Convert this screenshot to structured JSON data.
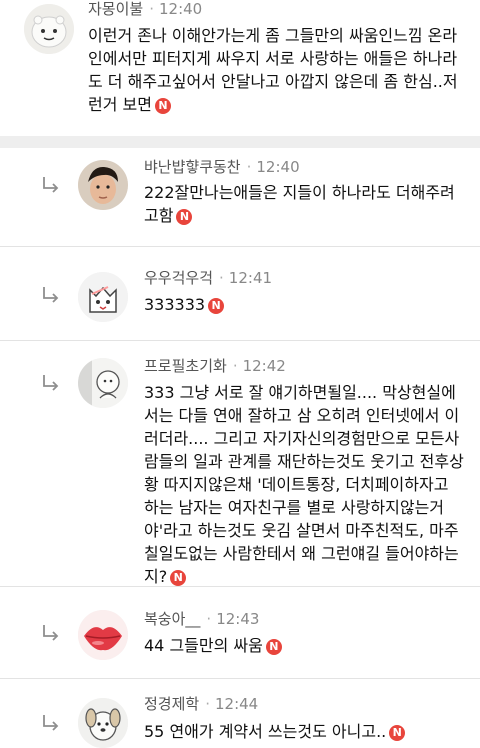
{
  "comments": [
    {
      "nickname": "자몽이불",
      "time": "12:40",
      "text": "이런거 존나 이해안가는게 좀 그들만의 싸움인느낌 온라인에서만 피터지게 싸우지 서로 사랑하는 애들은 하나라도 더 해주고싶어서 안달나고 아깝지 않은데 좀 한심..저런거 보면",
      "badge": "N",
      "avatar_icon": "character-avatar-icon",
      "is_reply": false
    },
    {
      "nickname": "뱌난뱝햫쿠동찬",
      "time": "12:40",
      "text": "222잘만나는애들은 지들이 하나라도 더해주려고함",
      "badge": "N",
      "avatar_icon": "person-photo-avatar-icon",
      "is_reply": true
    },
    {
      "nickname": "우우걱우걱",
      "time": "12:41",
      "text": "333333",
      "badge": "N",
      "avatar_icon": "cat-sketch-avatar-icon",
      "is_reply": true
    },
    {
      "nickname": "프로필초기화",
      "time": "12:42",
      "text": "333 그냥 서로 잘 얘기하면될일.... 막상현실에서는 다들 연애 잘하고 삼 오히려 인터넷에서 이러더라.... 그리고 자기자신의경험만으로 모든사람들의 일과 관계를 재단하는것도 웃기고 전후상황 따지지않은채 '데이트통장, 더치페이하자고 하는 남자는 여자친구를 별로 사랑하지않는거야'라고 하는것도 웃김 살면서 마주친적도, 마주칠일도없는 사람한테서 왜 그런얘길 들어야하는지?",
      "badge": "N",
      "avatar_icon": "drawing-avatar-icon",
      "is_reply": true
    },
    {
      "nickname": "복숭아__",
      "time": "12:43",
      "text": "44 그들만의 싸움",
      "badge": "N",
      "avatar_icon": "lips-avatar-icon",
      "is_reply": true
    },
    {
      "nickname": "정경제학",
      "time": "12:44",
      "text": "55 연애가 계약서 쓰는것도 아니고..",
      "badge": "N",
      "avatar_icon": "dog-character-avatar-icon",
      "is_reply": true
    }
  ],
  "colors": {
    "badge": "#e8453c",
    "divider": "#eeeeee",
    "nickname": "#555555",
    "time": "#888888"
  }
}
